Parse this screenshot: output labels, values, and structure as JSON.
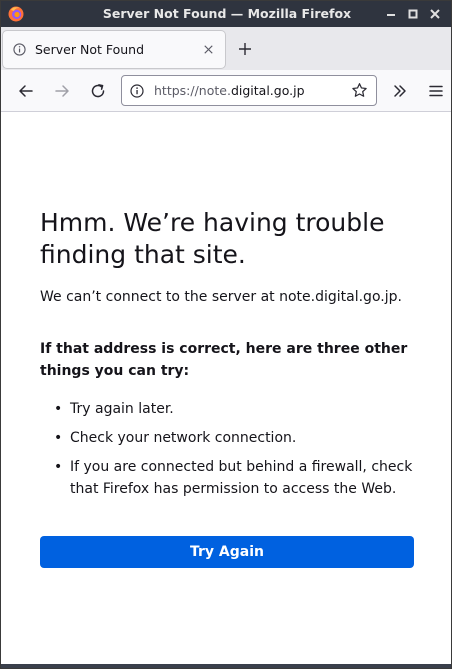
{
  "window": {
    "title": "Server Not Found — Mozilla Firefox"
  },
  "tab": {
    "label": "Server Not Found"
  },
  "urlbar": {
    "prefix": "https://note.",
    "domain": "digital.go.jp"
  },
  "error": {
    "heading": "Hmm. We’re having trouble finding that site.",
    "description": "We can’t connect to the server at note.digital.go.jp.",
    "tips_heading": "If that address is correct, here are three other things you can try:",
    "tips": [
      "Try again later.",
      "Check your network connection.",
      "If you are connected but behind a firewall, check that Firefox has permission to access the Web."
    ],
    "button_label": "Try Again"
  },
  "colors": {
    "titlebar": "#2f343f",
    "accent_button": "#0061e0",
    "text": "#15141a"
  },
  "icons": {
    "window_logo": "firefox-icon",
    "tab": "info-icon",
    "tab_close": "close-icon",
    "new_tab": "plus-icon",
    "back": "back-arrow-icon",
    "forward": "forward-arrow-icon",
    "reload": "reload-icon",
    "site_info": "info-icon",
    "bookmark": "star-icon",
    "overflow": "double-chevron-icon",
    "menu": "hamburger-menu-icon"
  }
}
